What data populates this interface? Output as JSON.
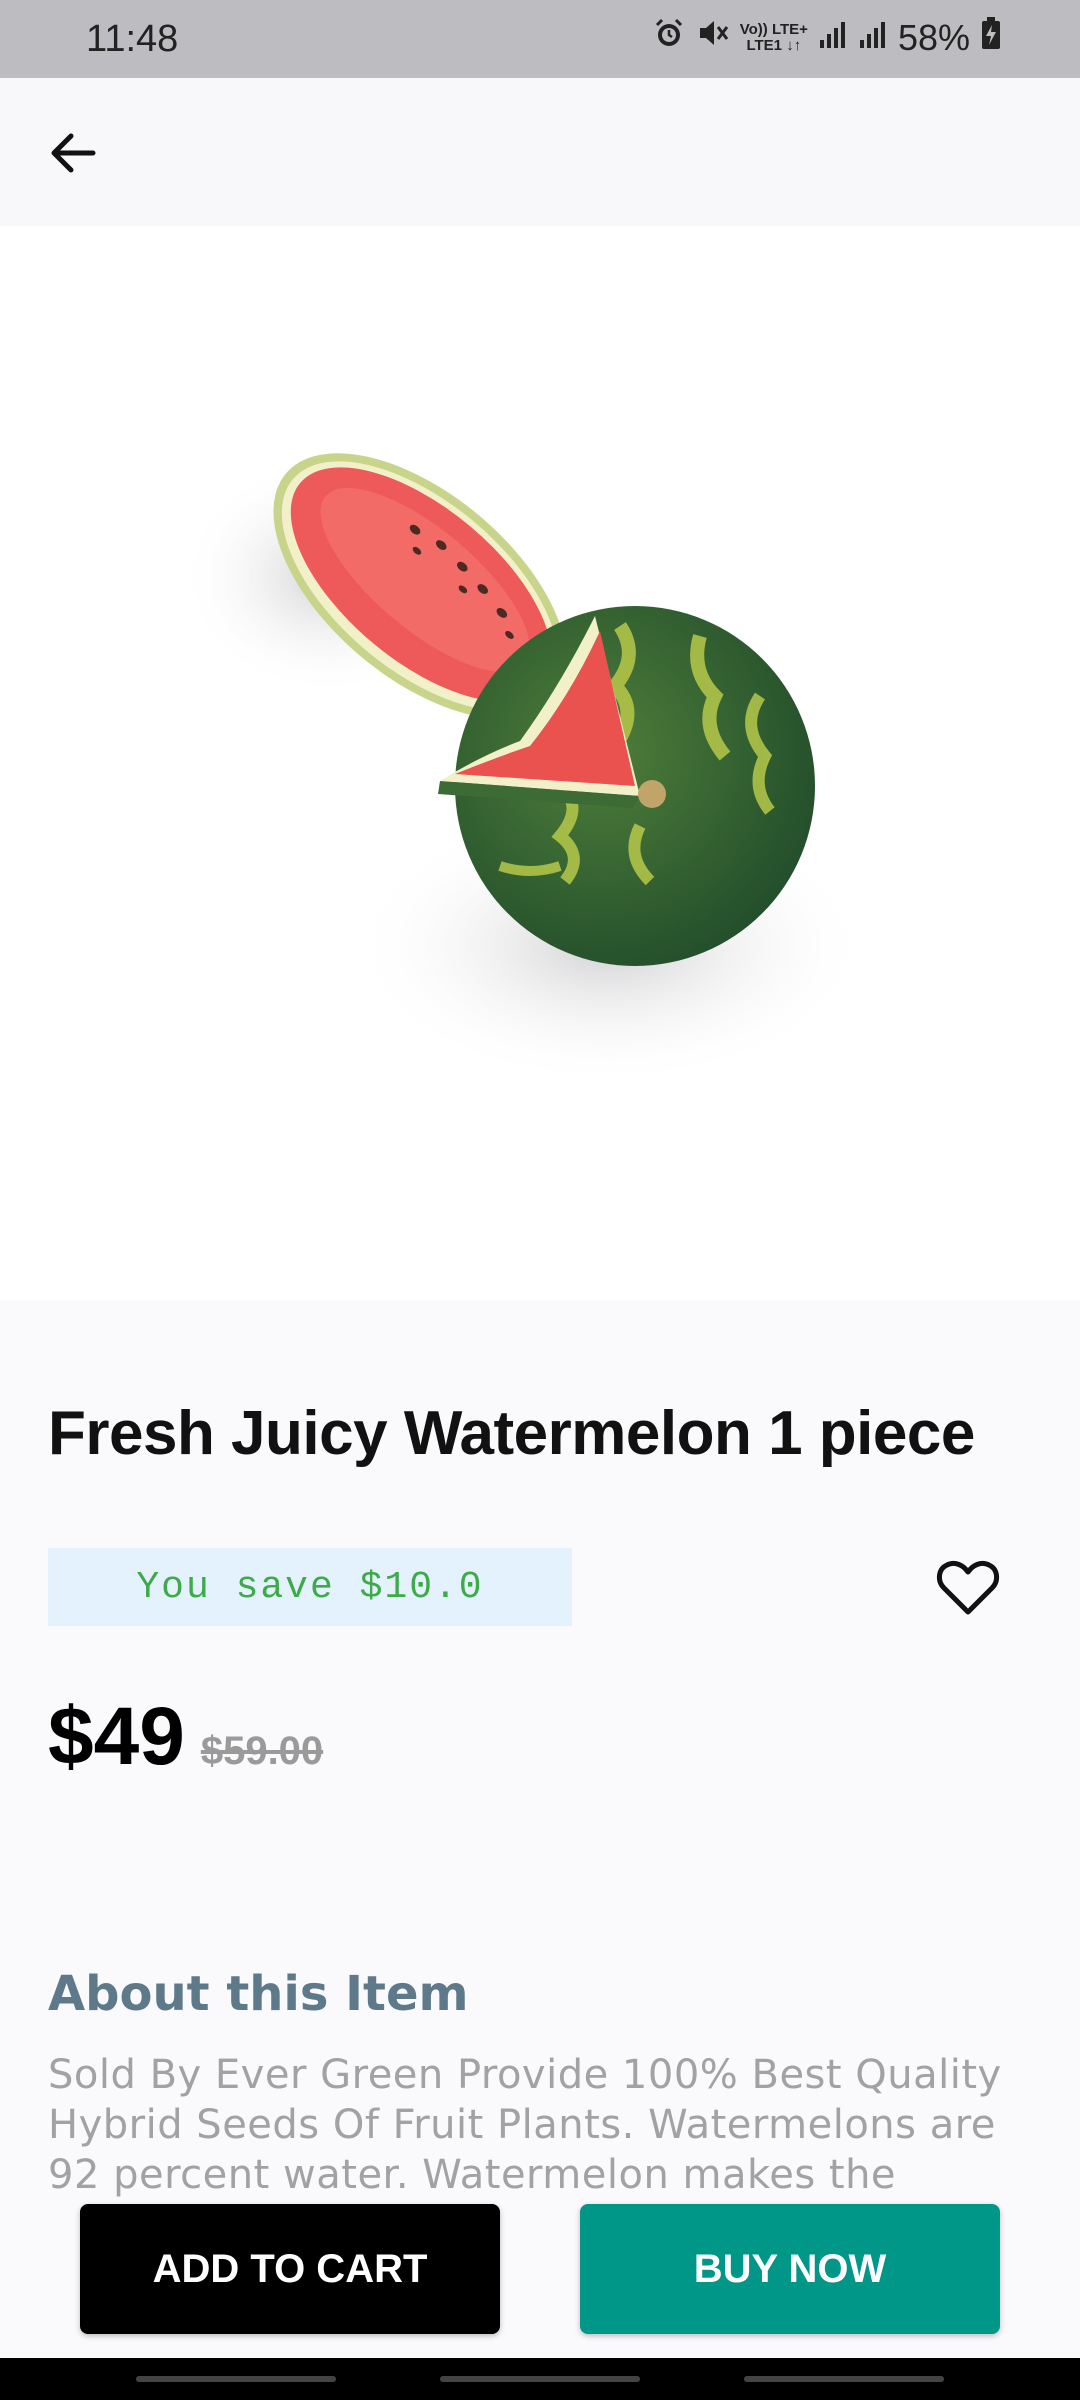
{
  "status_bar": {
    "time": "11:48",
    "network_top": "Vo)) LTE+",
    "network_bottom": "LTE1 ↓↑",
    "battery": "58%",
    "icons": [
      "alarm-icon",
      "mute-icon",
      "signal-icon",
      "signal-icon",
      "battery-charging-icon"
    ]
  },
  "header": {
    "back_icon": "arrow-left-icon"
  },
  "product": {
    "image": "watermelon-photo",
    "title": "Fresh Juicy Watermelon 1 piece",
    "save_text": "You save $10.0",
    "price": "$49",
    "old_price": "$59.00",
    "wishlist_icon": "heart-outline-icon"
  },
  "about": {
    "title": "About this Item",
    "text": "Sold By Ever Green Provide 100% Best Quality Hybrid Seeds Of Fruit Plants. Watermelons are 92 percent water. Watermelon makes the"
  },
  "actions": {
    "add_to_cart": "ADD TO CART",
    "buy_now": "BUY NOW"
  },
  "colors": {
    "accent": "#009688",
    "save_text": "#3faa4a",
    "save_bg": "#e3f2fd",
    "about_title": "#5e7a8a"
  }
}
